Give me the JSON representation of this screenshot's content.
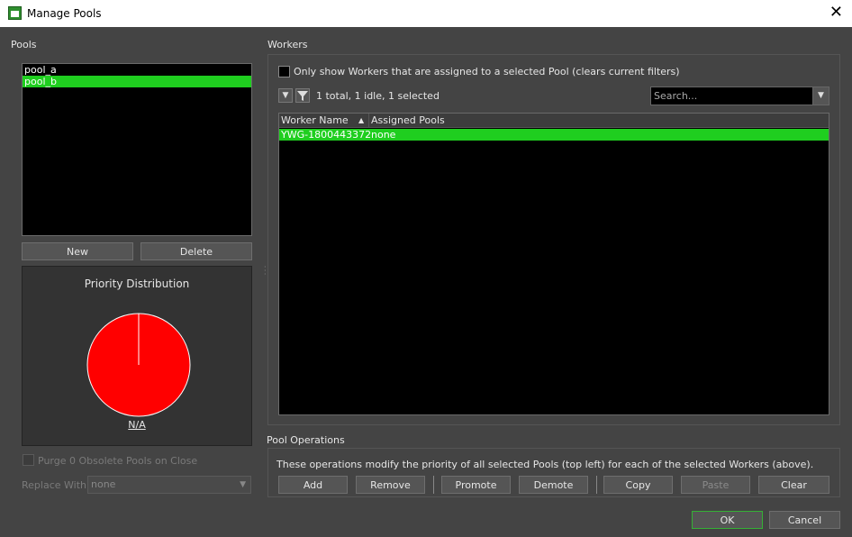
{
  "window": {
    "title": "Manage Pools"
  },
  "pools": {
    "section_label": "Pools",
    "items": [
      {
        "label": "pool_a",
        "selected": false
      },
      {
        "label": "pool_b",
        "selected": true
      }
    ],
    "new_label": "New",
    "delete_label": "Delete",
    "chart_title": "Priority Distribution",
    "purge_label": "Purge 0 Obsolete Pools on Close",
    "replace_label": "Replace With:",
    "replace_value": "none"
  },
  "chart_data": {
    "type": "pie",
    "title": "Priority Distribution",
    "slices": [
      {
        "label": "N/A",
        "value": 100,
        "color": "#ff0000"
      }
    ],
    "legend": [
      "N/A"
    ]
  },
  "workers": {
    "section_label": "Workers",
    "only_show_label": "Only show Workers that are assigned to a selected Pool (clears current filters)",
    "status_text": "1 total, 1 idle, 1 selected",
    "search_placeholder": "Search...",
    "columns": [
      "Worker Name",
      "Assigned Pools"
    ],
    "rows": [
      {
        "name": "YWG-1800443372",
        "pools": "none",
        "selected": true
      }
    ]
  },
  "pool_operations": {
    "section_label": "Pool Operations",
    "description": "These operations modify the priority of all selected Pools (top left) for each of the selected Workers (above).",
    "buttons": {
      "add": "Add",
      "remove": "Remove",
      "promote": "Promote",
      "demote": "Demote",
      "copy": "Copy",
      "paste": "Paste",
      "clear": "Clear"
    }
  },
  "footer": {
    "ok": "OK",
    "cancel": "Cancel"
  },
  "colors": {
    "selection": "#1fce1f",
    "pie": "#ff0000",
    "background": "#444444"
  }
}
